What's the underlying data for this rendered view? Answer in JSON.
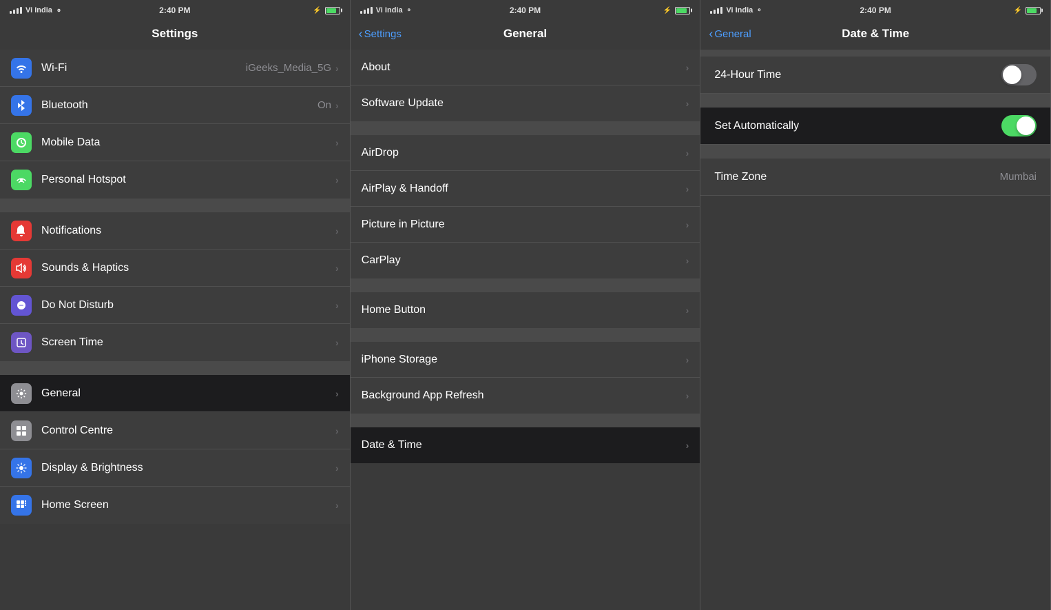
{
  "panels": {
    "panel1": {
      "title": "Settings",
      "status": {
        "carrier": "Vi India",
        "time": "2:40 PM",
        "wifi": true,
        "battery": 85
      },
      "sections": [
        {
          "items": [
            {
              "id": "wifi",
              "label": "Wi-Fi",
              "value": "iGeeks_Media_5G",
              "icon": "📶",
              "iconClass": "icon-wifi"
            },
            {
              "id": "bluetooth",
              "label": "Bluetooth",
              "value": "On",
              "icon": "🔵",
              "iconClass": "icon-bluetooth"
            },
            {
              "id": "mobiledata",
              "label": "Mobile Data",
              "value": "",
              "icon": "📡",
              "iconClass": "icon-mobiledata"
            },
            {
              "id": "hotspot",
              "label": "Personal Hotspot",
              "value": "",
              "icon": "📶",
              "iconClass": "icon-hotspot"
            }
          ]
        },
        {
          "items": [
            {
              "id": "notifications",
              "label": "Notifications",
              "value": "",
              "icon": "🔔",
              "iconClass": "icon-notifications"
            },
            {
              "id": "sounds",
              "label": "Sounds & Haptics",
              "value": "",
              "icon": "🔊",
              "iconClass": "icon-sounds"
            },
            {
              "id": "donotdisturb",
              "label": "Do Not Disturb",
              "value": "",
              "icon": "🌙",
              "iconClass": "icon-donotdisturb"
            },
            {
              "id": "screentime",
              "label": "Screen Time",
              "value": "",
              "icon": "⏱",
              "iconClass": "icon-screentime"
            }
          ]
        },
        {
          "items": [
            {
              "id": "general",
              "label": "General",
              "value": "",
              "icon": "⚙️",
              "iconClass": "icon-general",
              "selected": true
            },
            {
              "id": "controlcentre",
              "label": "Control Centre",
              "value": "",
              "icon": "▦",
              "iconClass": "icon-controlcentre"
            },
            {
              "id": "display",
              "label": "Display & Brightness",
              "value": "",
              "icon": "☀️",
              "iconClass": "icon-display"
            },
            {
              "id": "homescreen",
              "label": "Home Screen",
              "value": "",
              "icon": "⠿",
              "iconClass": "icon-homescreen"
            }
          ]
        }
      ]
    },
    "panel2": {
      "title": "General",
      "backLabel": "Settings",
      "status": {
        "carrier": "Vi India",
        "time": "2:40 PM"
      },
      "sections": [
        {
          "items": [
            {
              "id": "about",
              "label": "About"
            },
            {
              "id": "softwareupdate",
              "label": "Software Update"
            }
          ]
        },
        {
          "items": [
            {
              "id": "airdrop",
              "label": "AirDrop"
            },
            {
              "id": "airplay",
              "label": "AirPlay & Handoff"
            },
            {
              "id": "pip",
              "label": "Picture in Picture"
            },
            {
              "id": "carplay",
              "label": "CarPlay"
            }
          ]
        },
        {
          "items": [
            {
              "id": "homebutton",
              "label": "Home Button"
            }
          ]
        },
        {
          "items": [
            {
              "id": "iphonestorage",
              "label": "iPhone Storage"
            },
            {
              "id": "backgroundrefresh",
              "label": "Background App Refresh"
            }
          ]
        },
        {
          "items": [
            {
              "id": "datetime",
              "label": "Date & Time",
              "selected": true
            }
          ]
        }
      ]
    },
    "panel3": {
      "title": "Date & Time",
      "backLabel": "General",
      "status": {
        "carrier": "Vi India",
        "time": "2:40 PM"
      },
      "rows": [
        {
          "id": "24hour",
          "label": "24-Hour Time",
          "type": "toggle",
          "value": false,
          "darkBg": false
        },
        {
          "id": "setauto",
          "label": "Set Automatically",
          "type": "toggle",
          "value": true,
          "darkBg": true
        },
        {
          "id": "timezone",
          "label": "Time Zone",
          "type": "value",
          "value": "Mumbai",
          "darkBg": false
        }
      ]
    }
  },
  "icons": {
    "wifi_symbol": "📶",
    "bluetooth_symbol": "✦",
    "chevron": "›",
    "back_chevron": "‹"
  }
}
